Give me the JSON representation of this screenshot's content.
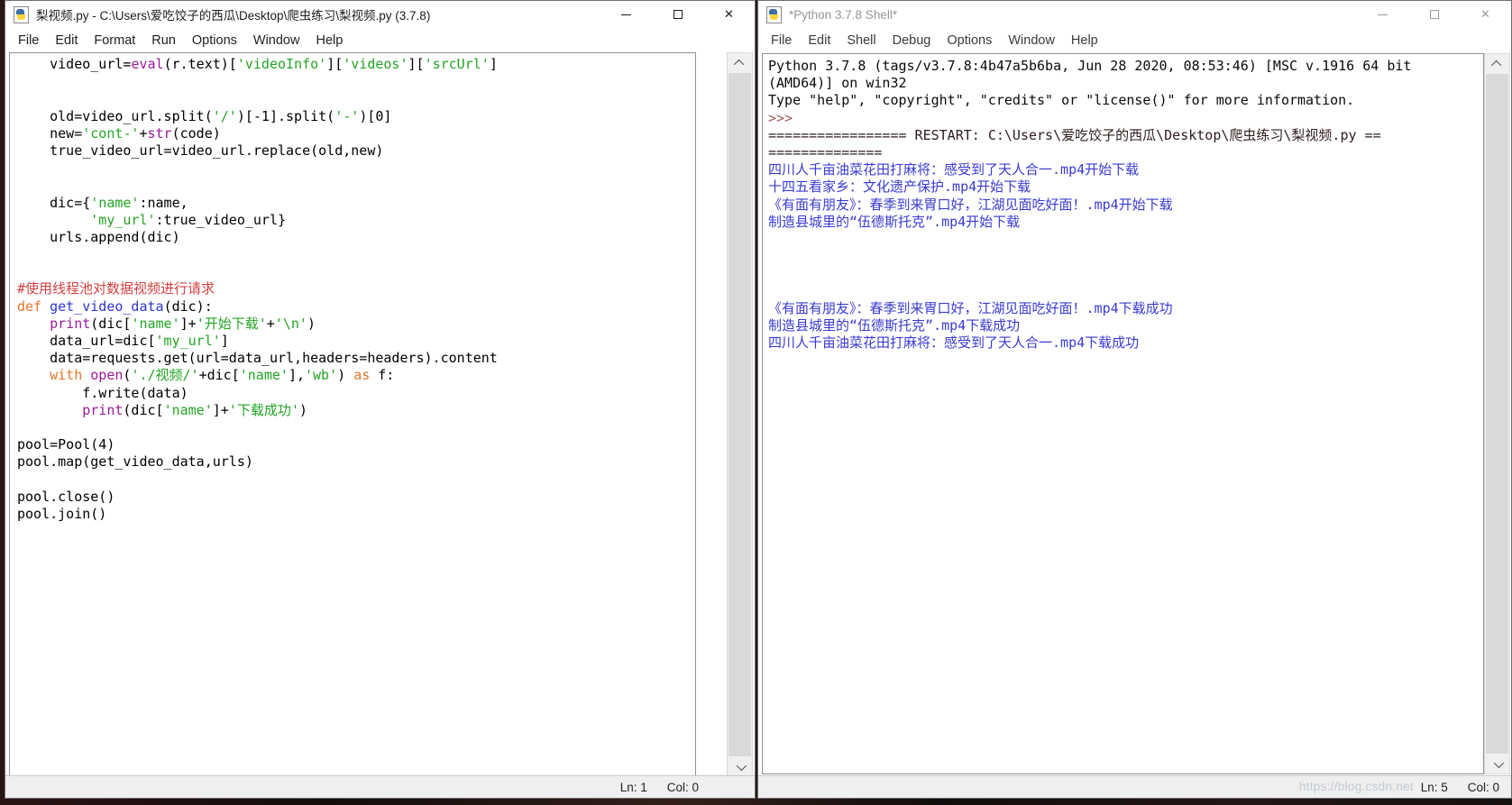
{
  "editor_window": {
    "title": "梨视频.py - C:\\Users\\爱吃饺子的西瓜\\Desktop\\爬虫练习\\梨视频.py (3.7.8)",
    "menu": [
      "File",
      "Edit",
      "Format",
      "Run",
      "Options",
      "Window",
      "Help"
    ],
    "status": {
      "line": "Ln: 1",
      "col": "Col: 0"
    },
    "code_lines": [
      [
        [
          "p",
          "    video_url="
        ],
        [
          "b",
          "eval"
        ],
        [
          "p",
          "(r.text)["
        ],
        [
          "s",
          "'videoInfo'"
        ],
        [
          "p",
          "]["
        ],
        [
          "s",
          "'videos'"
        ],
        [
          "p",
          "]["
        ],
        [
          "s",
          "'srcUrl'"
        ],
        [
          "p",
          "]"
        ]
      ],
      [],
      [],
      [
        [
          "p",
          "    old=video_url.split("
        ],
        [
          "s",
          "'/'"
        ],
        [
          "p",
          ")[-1].split("
        ],
        [
          "s",
          "'-'"
        ],
        [
          "p",
          ")[0]"
        ]
      ],
      [
        [
          "p",
          "    new="
        ],
        [
          "s",
          "'cont-'"
        ],
        [
          "p",
          "+"
        ],
        [
          "b",
          "str"
        ],
        [
          "p",
          "(code)"
        ]
      ],
      [
        [
          "p",
          "    true_video_url=video_url.replace(old,new)"
        ]
      ],
      [],
      [],
      [
        [
          "p",
          "    dic={"
        ],
        [
          "s",
          "'name'"
        ],
        [
          "p",
          ":name,"
        ]
      ],
      [
        [
          "p",
          "         "
        ],
        [
          "s",
          "'my_url'"
        ],
        [
          "p",
          ":true_video_url}"
        ]
      ],
      [
        [
          "p",
          "    urls.append(dic)"
        ]
      ],
      [],
      [],
      [
        [
          "c",
          "#使用线程池对数据视频进行请求"
        ]
      ],
      [
        [
          "k",
          "def"
        ],
        [
          "p",
          " "
        ],
        [
          "d",
          "get_video_data"
        ],
        [
          "p",
          "(dic):"
        ]
      ],
      [
        [
          "p",
          "    "
        ],
        [
          "b",
          "print"
        ],
        [
          "p",
          "(dic["
        ],
        [
          "s",
          "'name'"
        ],
        [
          "p",
          "]+"
        ],
        [
          "s",
          "'开始下载'"
        ],
        [
          "p",
          "+"
        ],
        [
          "s",
          "'\\n'"
        ],
        [
          "p",
          ")"
        ]
      ],
      [
        [
          "p",
          "    data_url=dic["
        ],
        [
          "s",
          "'my_url'"
        ],
        [
          "p",
          "]"
        ]
      ],
      [
        [
          "p",
          "    data=requests.get(url=data_url,headers=headers).content"
        ]
      ],
      [
        [
          "p",
          "    "
        ],
        [
          "k",
          "with"
        ],
        [
          "p",
          " "
        ],
        [
          "b",
          "open"
        ],
        [
          "p",
          "("
        ],
        [
          "s",
          "'./视频/'"
        ],
        [
          "p",
          "+dic["
        ],
        [
          "s",
          "'name'"
        ],
        [
          "p",
          "],"
        ],
        [
          "s",
          "'wb'"
        ],
        [
          "p",
          ") "
        ],
        [
          "k",
          "as"
        ],
        [
          "p",
          " f:"
        ]
      ],
      [
        [
          "p",
          "        f.write(data)"
        ]
      ],
      [
        [
          "p",
          "        "
        ],
        [
          "b",
          "print"
        ],
        [
          "p",
          "(dic["
        ],
        [
          "s",
          "'name'"
        ],
        [
          "p",
          "]+"
        ],
        [
          "s",
          "'下载成功'"
        ],
        [
          "p",
          ")"
        ]
      ],
      [],
      [
        [
          "p",
          "pool=Pool(4)"
        ]
      ],
      [
        [
          "p",
          "pool.map(get_video_data,urls)"
        ]
      ],
      [],
      [
        [
          "p",
          "pool.close()"
        ]
      ],
      [
        [
          "p",
          "pool.join()"
        ]
      ]
    ]
  },
  "shell_window": {
    "title": "*Python 3.7.8 Shell*",
    "menu": [
      "File",
      "Edit",
      "Shell",
      "Debug",
      "Options",
      "Window",
      "Help"
    ],
    "status": {
      "line": "Ln: 5",
      "col": "Col: 0"
    },
    "watermark": "https://blog.csdn.net",
    "lines": [
      [
        "n",
        "Python 3.7.8 (tags/v3.7.8:4b47a5b6ba, Jun 28 2020, 08:53:46) [MSC v.1916 64 bit"
      ],
      [
        "n",
        "(AMD64)] on win32"
      ],
      [
        "n",
        "Type \"help\", \"copyright\", \"credits\" or \"license()\" for more information."
      ],
      [
        "pr",
        ">>>"
      ],
      [
        "r",
        "================= RESTART: C:\\Users\\爱吃饺子的西瓜\\Desktop\\爬虫练习\\梨视频.py =="
      ],
      [
        "r",
        "=============="
      ],
      [
        "o",
        "四川人千亩油菜花田打麻将：感受到了天人合一.mp4开始下载"
      ],
      [
        "o",
        "十四五看家乡：文化遗产保护.mp4开始下载"
      ],
      [
        "o",
        "《有面有朋友》：春季到来胃口好，江湖见面吃好面！.mp4开始下载"
      ],
      [
        "o",
        "制造县城里的“伍德斯托克”.mp4开始下载"
      ],
      [
        "n",
        ""
      ],
      [
        "n",
        ""
      ],
      [
        "n",
        ""
      ],
      [
        "n",
        ""
      ],
      [
        "o",
        "《有面有朋友》：春季到来胃口好，江湖见面吃好面！.mp4下载成功"
      ],
      [
        "o",
        "制造县城里的“伍德斯托克”.mp4下载成功"
      ],
      [
        "o",
        "四川人千亩油菜花田打麻将：感受到了天人合一.mp4下载成功"
      ]
    ]
  },
  "icons": {
    "close_glyph": "✕"
  },
  "colors": {
    "plain": "#000000",
    "keyword": "#e1762a",
    "builtin": "#9a1b9a",
    "string": "#23a423",
    "comment": "#d24040",
    "definition": "#2b35cf",
    "shell_text": "#0a0a0a",
    "stdout": "#3a3ad0",
    "prompt": "#a05858",
    "restart": "#2e1c1c"
  }
}
